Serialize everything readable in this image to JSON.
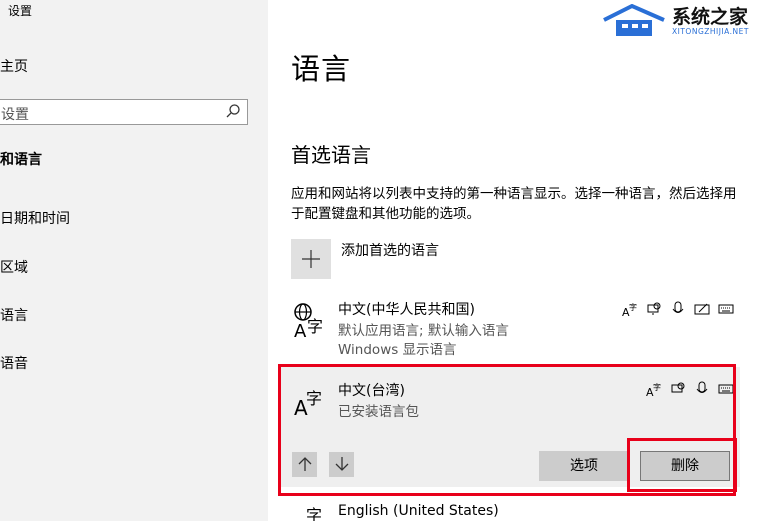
{
  "sidebar": {
    "title": "设置",
    "home": "主页",
    "search_placeholder": "设置",
    "section": "和语言",
    "items": [
      "日期和时间",
      "区域",
      "语言",
      "语音"
    ]
  },
  "main": {
    "title": "语言",
    "section_title": "首选语言",
    "description": "应用和网站将以列表中支持的第一种语言显示。选择一种语言，然后选择用于配置键盘和其他功能的选项。",
    "add_label": "添加首选的语言",
    "languages": [
      {
        "name": "中文(中华人民共和国)",
        "sub1": "默认应用语言; 默认输入语言",
        "sub2": "Windows 显示语言"
      },
      {
        "name": "中文(台湾)",
        "sub1": "已安装语言包"
      },
      {
        "name": "English (United States)"
      }
    ],
    "options_button": "选项",
    "delete_button": "删除"
  },
  "watermark": {
    "title": "系统之家",
    "url": "XITONGZHIJIA.NET"
  },
  "colors": {
    "highlight": "#e8001a",
    "sidebar_bg": "#f2f2f2",
    "button_bg": "#cccccc"
  }
}
